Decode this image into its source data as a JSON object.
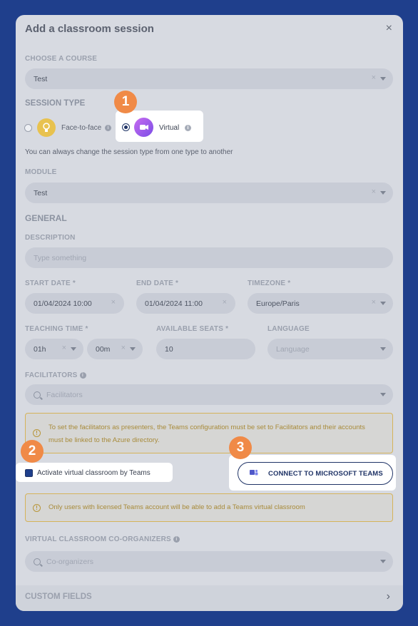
{
  "dialog": {
    "title": "Add a classroom session",
    "close_icon": "×"
  },
  "course": {
    "label": "CHOOSE A COURSE",
    "value": "Test"
  },
  "session_type": {
    "label": "SESSION TYPE",
    "option_face": "Face-to-face",
    "option_virtual": "Virtual",
    "selected": "Virtual",
    "hint": "You can always change the session type from one type to another"
  },
  "module": {
    "label": "MODULE",
    "value": "Test"
  },
  "general": {
    "heading": "GENERAL",
    "description_label": "DESCRIPTION",
    "description_placeholder": "Type something"
  },
  "dates": {
    "start_label": "START DATE *",
    "start_value": "01/04/2024 10:00",
    "end_label": "END DATE *",
    "end_value": "01/04/2024 11:00",
    "timezone_label": "TIMEZONE *",
    "timezone_value": "Europe/Paris"
  },
  "teaching": {
    "label": "TEACHING TIME *",
    "hours": "01h",
    "minutes": "00m",
    "seats_label": "AVAILABLE SEATS *",
    "seats_value": "10",
    "language_label": "LANGUAGE",
    "language_placeholder": "Language"
  },
  "facilitators": {
    "label": "FACILITATORS",
    "placeholder": "Facilitators",
    "warning": "To set the facilitators as presenters, the Teams configuration must be set to Facilitators and their accounts must be linked to the Azure directory."
  },
  "teams": {
    "checkbox_label": "Activate virtual classroom by Teams",
    "checked": true,
    "connect_button": "CONNECT TO MICROSOFT TEAMS",
    "warning": "Only users with licensed Teams account will be able to add a Teams virtual classroom"
  },
  "coorganizers": {
    "label": "VIRTUAL CLASSROOM CO-ORGANIZERS",
    "placeholder": "Co-organizers"
  },
  "custom_fields": {
    "label": "CUSTOM FIELDS"
  },
  "badges": [
    "1",
    "2",
    "3"
  ],
  "colors": {
    "backdrop": "#1f3f8c",
    "badge": "#f08a47",
    "teams_purple": "#5059c9",
    "warning_border": "#d5b35a"
  }
}
